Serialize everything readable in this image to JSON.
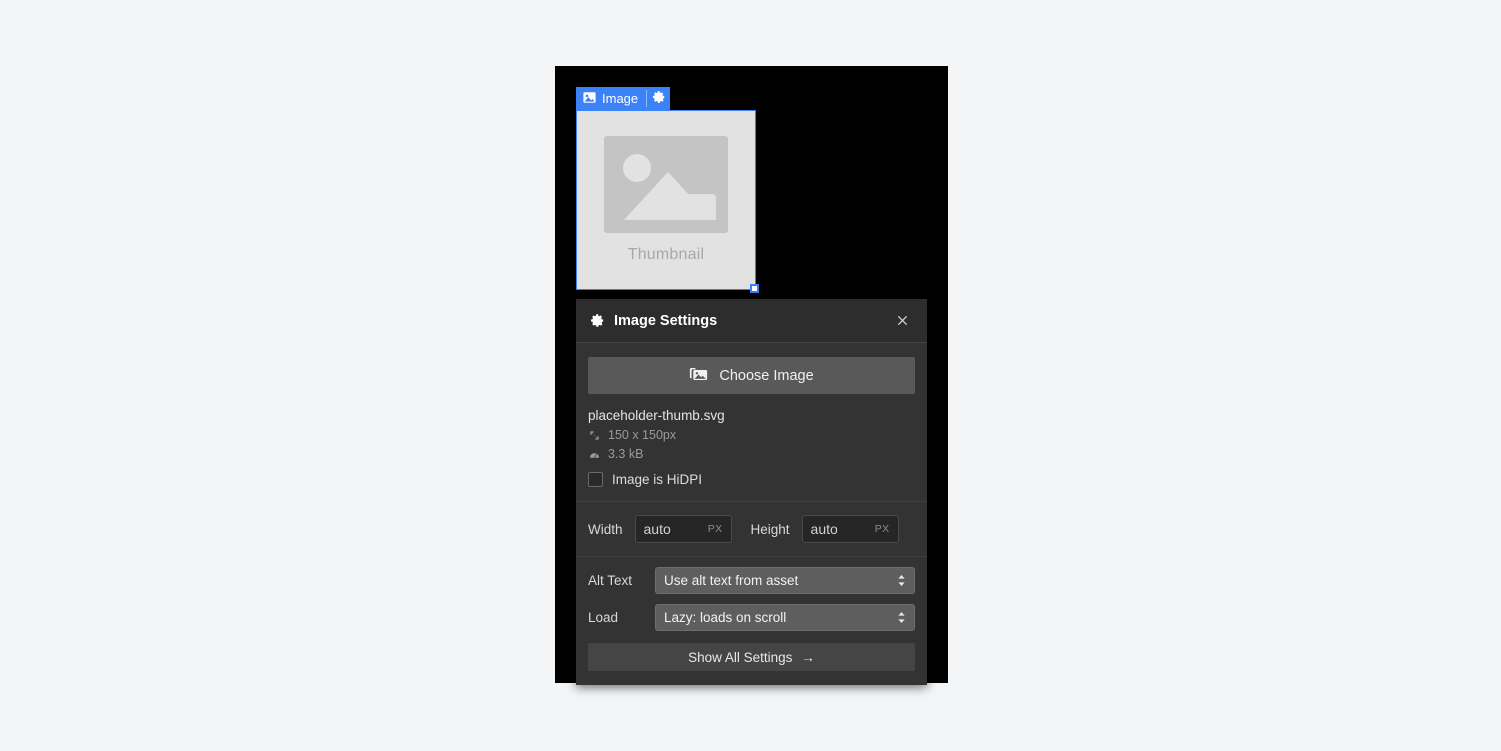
{
  "canvas": {
    "background": "#000000"
  },
  "block_toolbar": {
    "icon": "image-icon",
    "label": "Image",
    "settings_icon": "gear-icon",
    "accent_color": "#3b82f6"
  },
  "image_block": {
    "caption": "Thumbnail",
    "placeholder_icon": "image-placeholder-icon",
    "resize_handle": "resize-handle"
  },
  "panel": {
    "icon": "gear-icon",
    "title": "Image Settings",
    "close_icon": "close-icon",
    "choose_image": {
      "icon": "photo-library-icon",
      "label": "Choose Image"
    },
    "file": {
      "name": "placeholder-thumb.svg",
      "dimensions_icon": "resize-arrow-icon",
      "dimensions": "150 x 150px",
      "filesize_icon": "gauge-icon",
      "filesize": "3.3 kB"
    },
    "hidpi": {
      "label": "Image is HiDPI",
      "checked": false
    },
    "dimensions": {
      "width_label": "Width",
      "width_value": "auto",
      "width_unit": "PX",
      "height_label": "Height",
      "height_value": "auto",
      "height_unit": "PX"
    },
    "alt_text": {
      "label": "Alt Text",
      "value": "Use alt text from asset"
    },
    "load": {
      "label": "Load",
      "value": "Lazy: loads on scroll"
    },
    "show_all": {
      "label": "Show All Settings",
      "arrow": "→"
    }
  }
}
